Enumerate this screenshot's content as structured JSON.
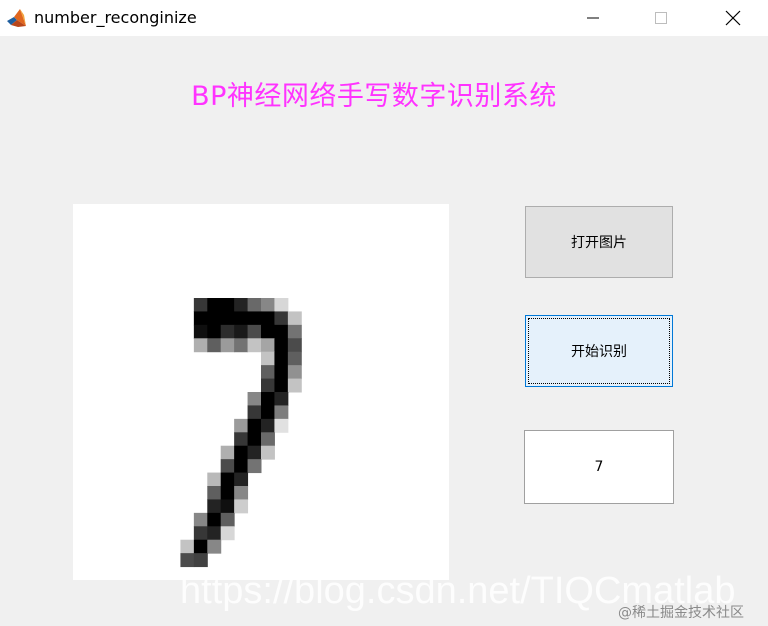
{
  "window": {
    "title": "number_reconginize",
    "buttons": {
      "minimize": "minimize-icon",
      "maximize": "maximize-icon",
      "close": "close-icon"
    }
  },
  "heading": {
    "text": "BP神经网络手写数字识别系统",
    "color": "#ff33ff"
  },
  "image_panel": {
    "content": "handwritten digit seven (pixelated grayscale)"
  },
  "controls": {
    "open_image_label": "打开图片",
    "start_recognition_label": "开始识别",
    "result_value": "7"
  },
  "watermarks": {
    "blog_url": "https://blog.csdn.net/TIQCmatlab",
    "community": "@稀土掘金技术社区"
  }
}
